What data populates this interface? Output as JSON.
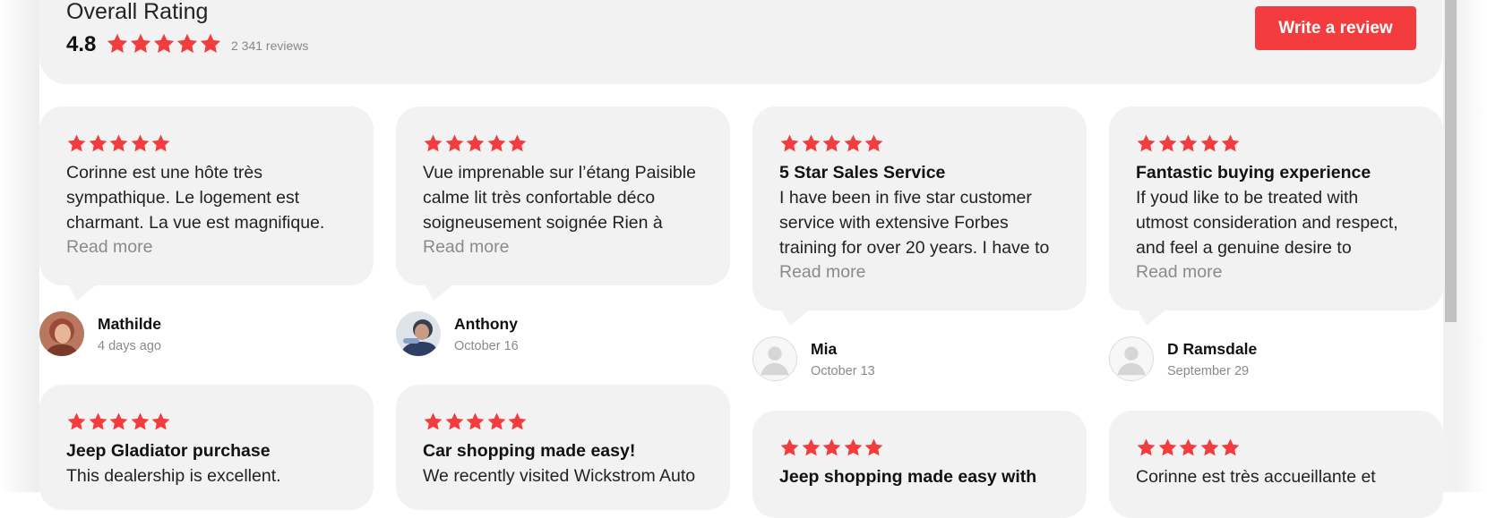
{
  "header": {
    "title": "Overall Rating",
    "score": "4.8",
    "stars": 5,
    "review_count": "2 341  reviews",
    "write_review_label": "Write a review"
  },
  "colors": {
    "accent": "#f23c3e",
    "star": "#f23c3e",
    "card_bg": "#f2f2f2",
    "muted": "#8a8a8a"
  },
  "reviews": [
    {
      "rating": 5,
      "title": "",
      "lines": [
        "Corinne est une hôte très",
        "sympathique. Le logement est",
        "charmant. La vue est magnifique."
      ],
      "read_more": "Read more",
      "author": "Mathilde",
      "date": "4 days ago",
      "avatar": "photo"
    },
    {
      "rating": 5,
      "title": "",
      "lines": [
        "Vue imprenable sur l’étang Paisible",
        "calme lit très confortable déco",
        "soigneusement soignée Rien à"
      ],
      "read_more": "Read more",
      "author": "Anthony",
      "date": "October 16",
      "avatar": "photo"
    },
    {
      "rating": 5,
      "title": "5 Star Sales Service",
      "lines": [
        "I have been in five star customer",
        "service with extensive Forbes",
        "training for over 20 years. I have to"
      ],
      "read_more": "Read more",
      "author": "Mia",
      "date": "October 13",
      "avatar": "placeholder"
    },
    {
      "rating": 5,
      "title": "Fantastic buying experience",
      "lines": [
        "If youd like to be treated with",
        "utmost consideration and respect,",
        "and feel a genuine desire to"
      ],
      "read_more": "Read more",
      "author": "D Ramsdale",
      "date": "September 29",
      "avatar": "placeholder"
    },
    {
      "rating": 5,
      "title": "Jeep Gladiator purchase",
      "lines": [
        "This dealership is excellent."
      ]
    },
    {
      "rating": 5,
      "title": "Car shopping made easy!",
      "lines": [
        "We recently visited Wickstrom Auto"
      ]
    },
    {
      "rating": 5,
      "title": "Jeep shopping made easy with",
      "lines": []
    },
    {
      "rating": 5,
      "title": "",
      "lines": [
        "Corinne est très accueillante et"
      ]
    }
  ]
}
